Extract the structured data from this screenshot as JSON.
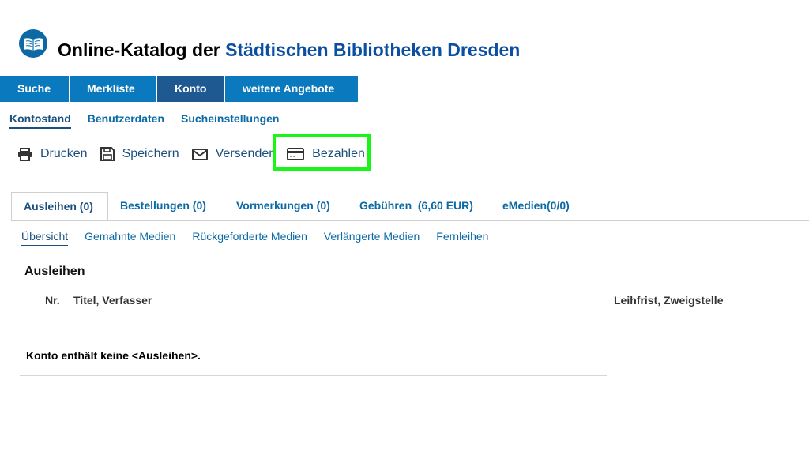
{
  "header": {
    "title_prefix": "Online-Katalog der ",
    "title_accent": "Städtischen Bibliotheken Dresden",
    "logo_icon": "library-book-logo-icon",
    "accent_color": "#0b4fa3"
  },
  "main_nav": {
    "items": [
      {
        "label": "Suche"
      },
      {
        "label": "Merkliste"
      },
      {
        "label": "Konto"
      },
      {
        "label": "weitere Angebote"
      }
    ],
    "active": "Konto",
    "color": "#0a79bd",
    "active_color": "#1e5a91"
  },
  "sub_nav": {
    "items": [
      {
        "label": "Kontostand"
      },
      {
        "label": "Benutzerdaten"
      },
      {
        "label": "Sucheinstellungen"
      }
    ],
    "active": "Kontostand"
  },
  "actions": {
    "print": {
      "label": "Drucken",
      "icon": "printer-icon"
    },
    "save": {
      "label": "Speichern",
      "icon": "floppy-disk-icon"
    },
    "send": {
      "label": "Versenden",
      "icon": "envelope-icon"
    },
    "pay": {
      "label": "Bezahlen",
      "icon": "credit-card-icon"
    },
    "highlight_color": "#19f519"
  },
  "tabs": {
    "items": [
      {
        "label": "Ausleihen (0)"
      },
      {
        "label": "Bestellungen (0)"
      },
      {
        "label": "Vormerkungen (0)"
      },
      {
        "label": "Gebühren  (6,60 EUR)"
      },
      {
        "label": "eMedien(0/0)"
      }
    ],
    "active": "Ausleihen (0)"
  },
  "filters": {
    "items": [
      {
        "label": "Übersicht"
      },
      {
        "label": "Gemahnte Medien"
      },
      {
        "label": "Rückgeforderte Medien"
      },
      {
        "label": "Verlängerte Medien"
      },
      {
        "label": "Fernleihen"
      }
    ],
    "active": "Übersicht"
  },
  "loans": {
    "section_title": "Ausleihen",
    "columns": {
      "nr": "Nr.",
      "title": "Titel, Verfasser",
      "due": "Leihfrist, Zweigstelle"
    },
    "empty_message": "Konto enthält keine <Ausleihen>."
  }
}
